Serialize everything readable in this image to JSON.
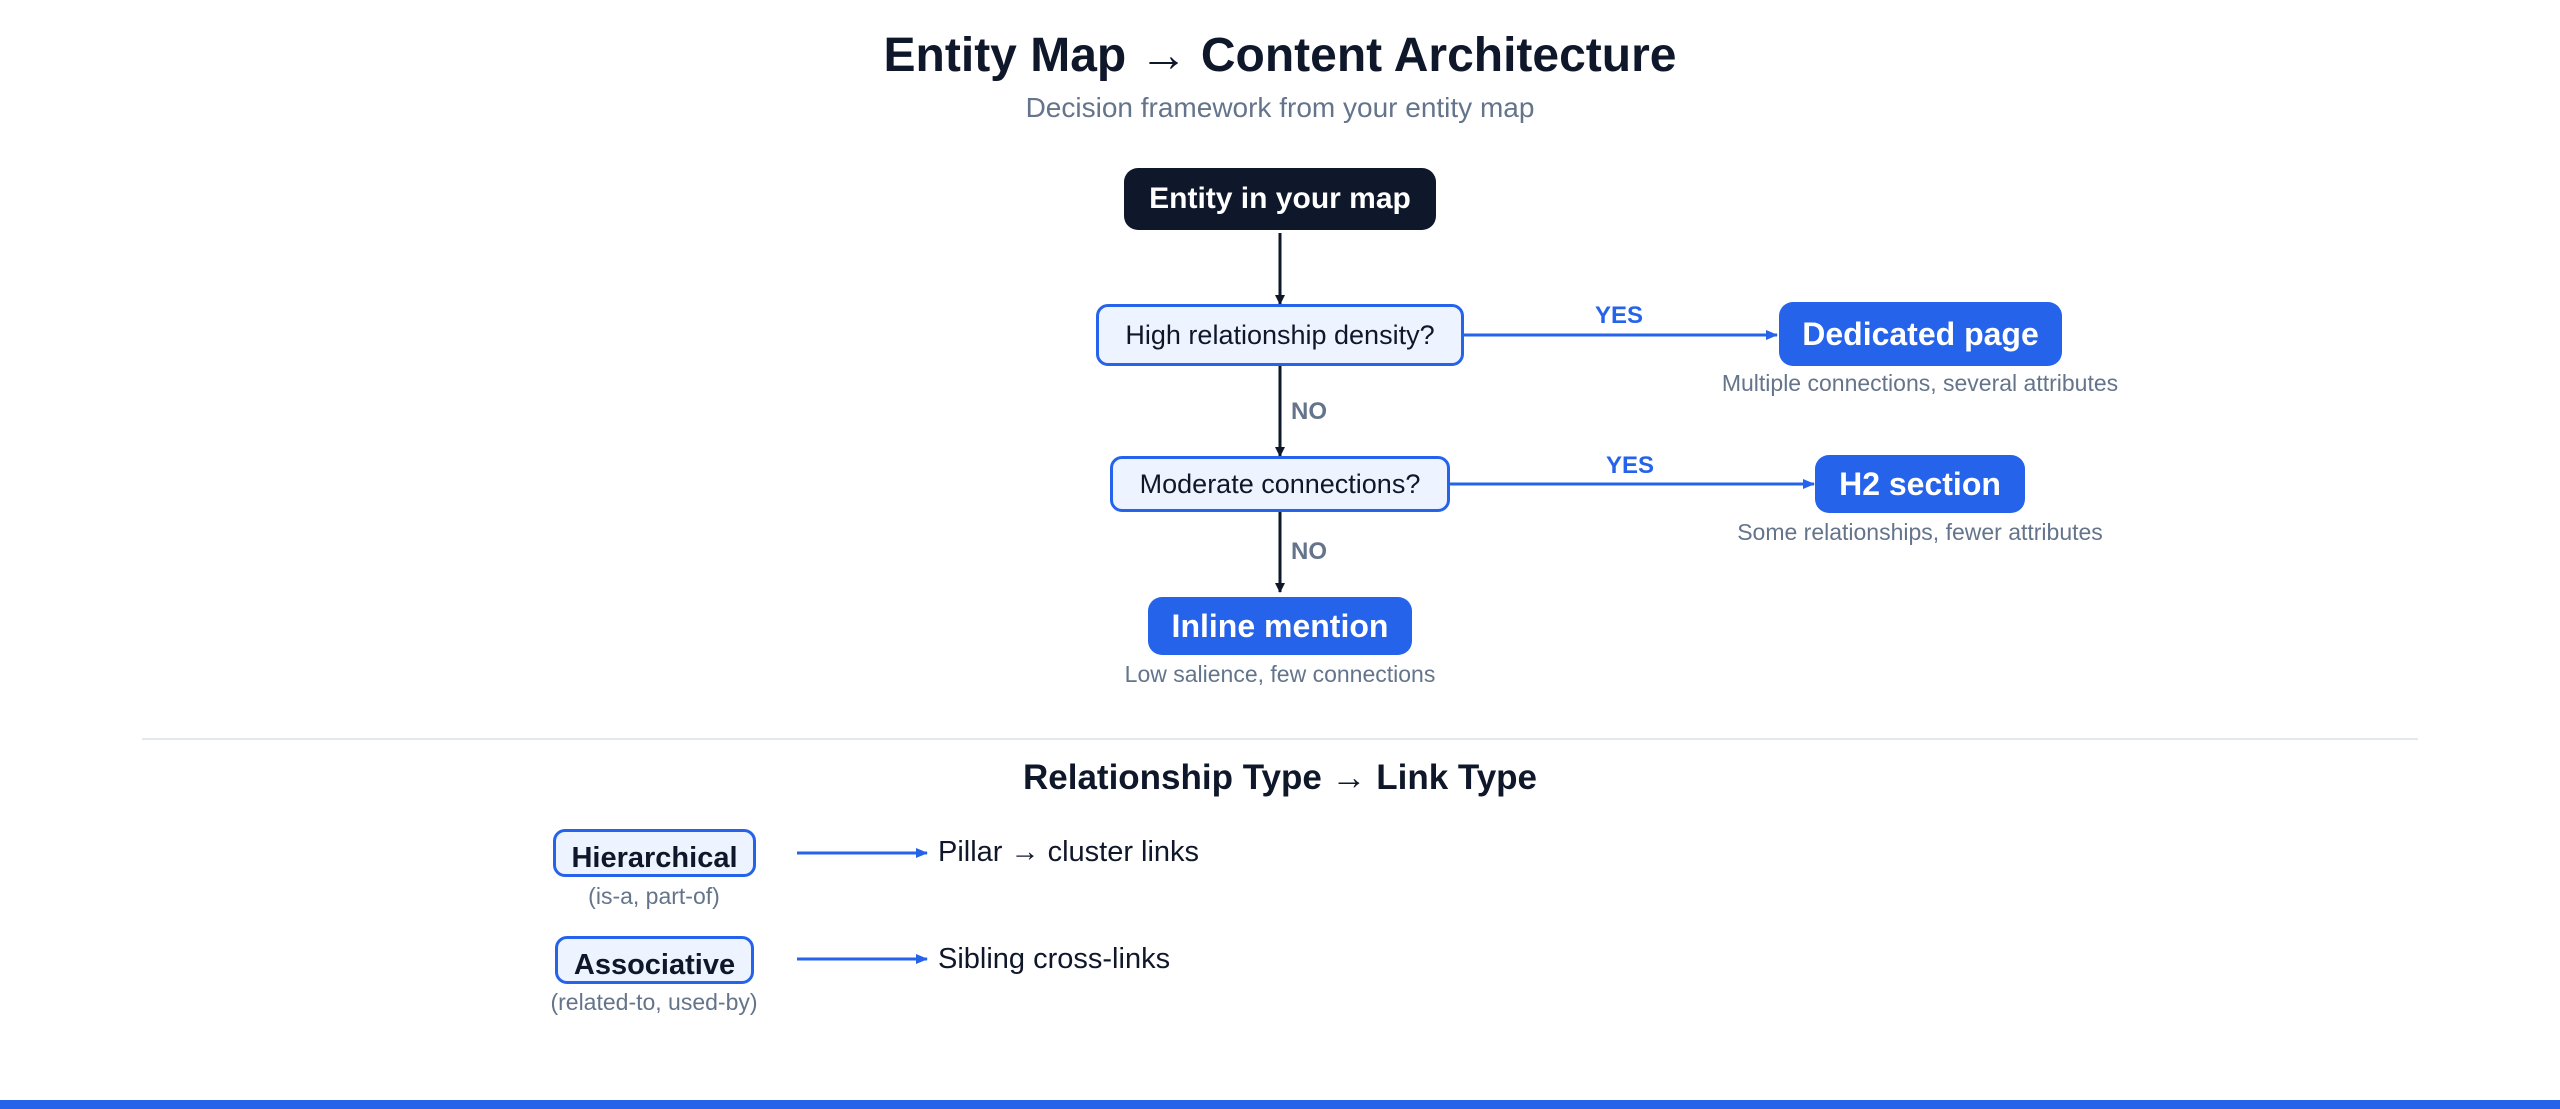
{
  "header": {
    "title": "Entity Map → Content Architecture",
    "subtitle": "Decision framework from your entity map"
  },
  "flowchart": {
    "start": "Entity in your map",
    "q1": "High relationship density?",
    "q2": "Moderate connections?",
    "yes_label": "YES",
    "no_label": "NO",
    "outcomes": {
      "dedicated": {
        "label": "Dedicated page",
        "caption": "Multiple connections, several attributes"
      },
      "h2": {
        "label": "H2 section",
        "caption": "Some relationships, fewer attributes"
      },
      "inline": {
        "label": "Inline mention",
        "caption": "Low salience, few connections"
      }
    }
  },
  "relationships": {
    "title": "Relationship Type → Link Type",
    "rows": [
      {
        "type": "Hierarchical",
        "examples": "(is-a, part-of)",
        "link": "Pillar → cluster links"
      },
      {
        "type": "Associative",
        "examples": "(related-to, used-by)",
        "link": "Sibling cross-links"
      }
    ]
  },
  "colors": {
    "accent": "#2563eb",
    "dark": "#0f172a",
    "muted": "#64748b",
    "light_fill": "#eef4ff"
  }
}
